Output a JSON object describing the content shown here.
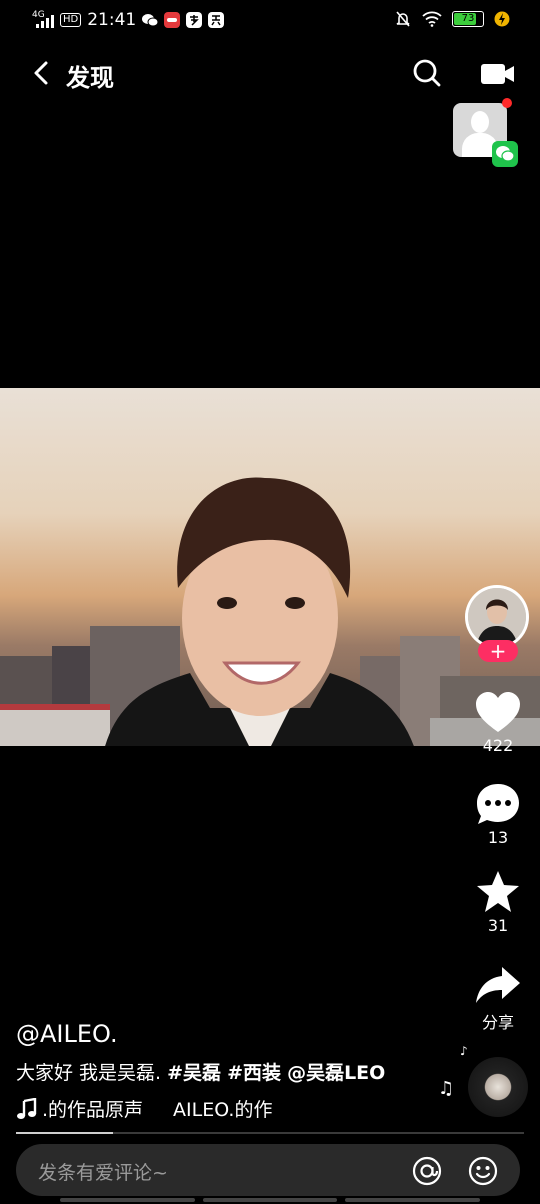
{
  "status": {
    "network": "4G",
    "hd": "HD",
    "time": "21:41",
    "battery": "73",
    "app_icons": [
      "WeChat",
      "JD",
      "Alipay",
      "Xiu"
    ]
  },
  "header": {
    "title": "发现"
  },
  "video": {
    "likes": "422",
    "comments": "13",
    "favorites": "31",
    "share_label": "分享",
    "progress": 0.19
  },
  "caption": {
    "author": "@AILEO.",
    "desc_text": "大家好 我是吴磊.",
    "hashtag1": "#吴磊",
    "hashtag2": "#西装",
    "mention": "@吴磊LEO",
    "music_text": ".的作品原声",
    "music_text2": "AILEO.的作"
  },
  "comment_bar": {
    "placeholder": "发条有爱评论~"
  },
  "colors": {
    "accent": "#fd2e63",
    "wechat": "#1fc34b",
    "battery": "#3ccd3c"
  }
}
